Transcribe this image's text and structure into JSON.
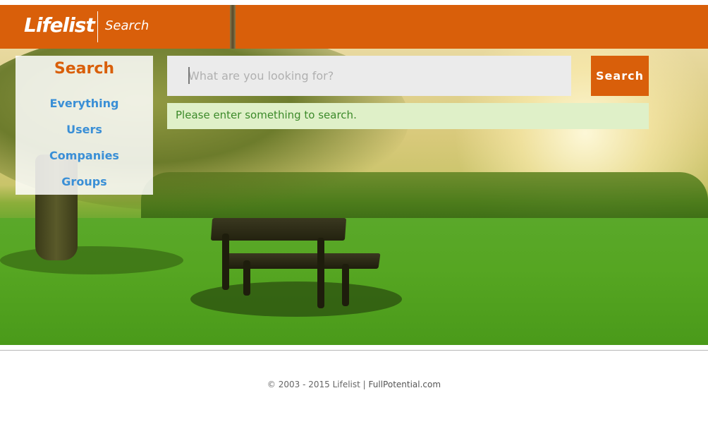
{
  "header": {
    "brand": "Lifelist",
    "section": "Search"
  },
  "sidebar": {
    "title": "Search",
    "items": [
      {
        "label": "Everything"
      },
      {
        "label": "Users"
      },
      {
        "label": "Companies"
      },
      {
        "label": "Groups"
      }
    ]
  },
  "search": {
    "placeholder": "What are you looking for?",
    "value": "",
    "button_label": "Search",
    "notice": "Please enter something to search."
  },
  "footer": {
    "copyright": "© 2003 - 2015 Lifelist",
    "separator": "|",
    "link": "FullPotential.com"
  },
  "colors": {
    "brand_orange": "#d95f0a",
    "link_blue": "#3a8fd6",
    "notice_bg": "#dff0c8",
    "notice_text": "#3c8a2a"
  }
}
